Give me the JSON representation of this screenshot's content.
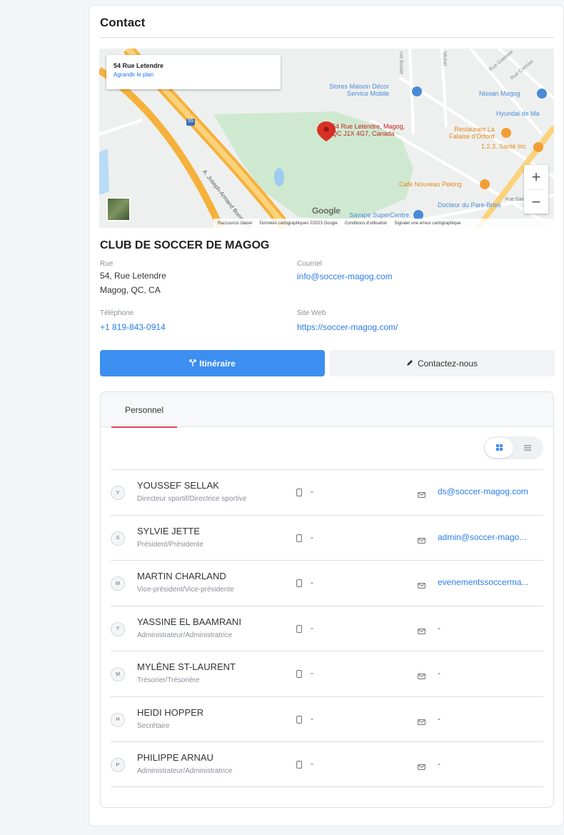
{
  "contact": {
    "title": "Contact",
    "map": {
      "info_address": "54 Rue Letendre",
      "info_link": "Agrandir le plan",
      "pin_label_1": "54 Rue Letendre, Magog,",
      "pin_label_2": "QC J1X 4G7, Canada",
      "places": {
        "stores": "Stores Maison Décor",
        "stores2": "Service Mobile",
        "nissan": "Nissan Magog",
        "hyundai": "Hyundai de Ma",
        "restaurant1": "Restaurant La",
        "restaurant2": "Falaise d'Orford",
        "sante": "1.2.3. Santé Inc",
        "cafe": "Cafe Nouveau Peking",
        "vape": "Savape SuperCentre",
        "docteur": "Docteur du Pare-Brise",
        "rue_saint": "Rue Saint",
        "road_joseph": "A. Joseph-Armand Bombardier",
        "route_shield": "55",
        "street_v1": "rue Boulet",
        "street_v2": "Michel",
        "street_gaetane": "Rue Gaetane",
        "street_cormier": "Rue Cormier"
      },
      "google": "Google",
      "footer": [
        "Raccourcis clavier",
        "Données cartographiques ©2023 Google",
        "Conditions d'utilisation",
        "Signaler une erreur cartographique"
      ],
      "zoom_in": "+",
      "zoom_out": "−"
    },
    "org_name": "CLUB DE SOCCER DE MAGOG",
    "rue_label": "Rue",
    "rue_line1": "54, Rue Letendre",
    "rue_line2": "Magog, QC, CA",
    "courriel_label": "Courriel",
    "courriel": "info@soccer-magog.com",
    "telephone_label": "Téléphone",
    "telephone": "+1 819-843-0914",
    "site_label": "Site Web",
    "site": "https://soccer-magog.com/",
    "btn_itineraire": "Itinéraire",
    "btn_contact": "Contactez-nous"
  },
  "personnel": {
    "tab_label": "Personnel",
    "staff": [
      {
        "initial": "Y",
        "name": "YOUSSEF SELLAK",
        "role": "Directeur sportif/Directrice sportive",
        "phone": "-",
        "email": "ds@soccer-magog.com",
        "email_is_link": true
      },
      {
        "initial": "S",
        "name": "SYLVIE JETTE",
        "role": "Président/Présidente",
        "phone": "-",
        "email": "admin@soccer-mago...",
        "email_is_link": true
      },
      {
        "initial": "M",
        "name": "MARTIN CHARLAND",
        "role": "Vice-président/Vice-présidente",
        "phone": "-",
        "email": "evenementssoccerma...",
        "email_is_link": true
      },
      {
        "initial": "Y",
        "name": "YASSINE EL BAAMRANI",
        "role": "Administrateur/Administratrice",
        "phone": "-",
        "email": "-",
        "email_is_link": false
      },
      {
        "initial": "M",
        "name": "MYLÈNE ST-LAURENT",
        "role": "Trésorier/Trésorière",
        "phone": "-",
        "email": "-",
        "email_is_link": false
      },
      {
        "initial": "H",
        "name": "HEIDI HOPPER",
        "role": "Secrétaire",
        "phone": "-",
        "email": "-",
        "email_is_link": false
      },
      {
        "initial": "P",
        "name": "PHILIPPE ARNAU",
        "role": "Administrateur/Administratrice",
        "phone": "-",
        "email": "-",
        "email_is_link": false
      }
    ]
  },
  "colors": {
    "accent_blue": "#3c8ef0",
    "tab_underline": "#e2445c",
    "map_pin": "#d93025"
  }
}
